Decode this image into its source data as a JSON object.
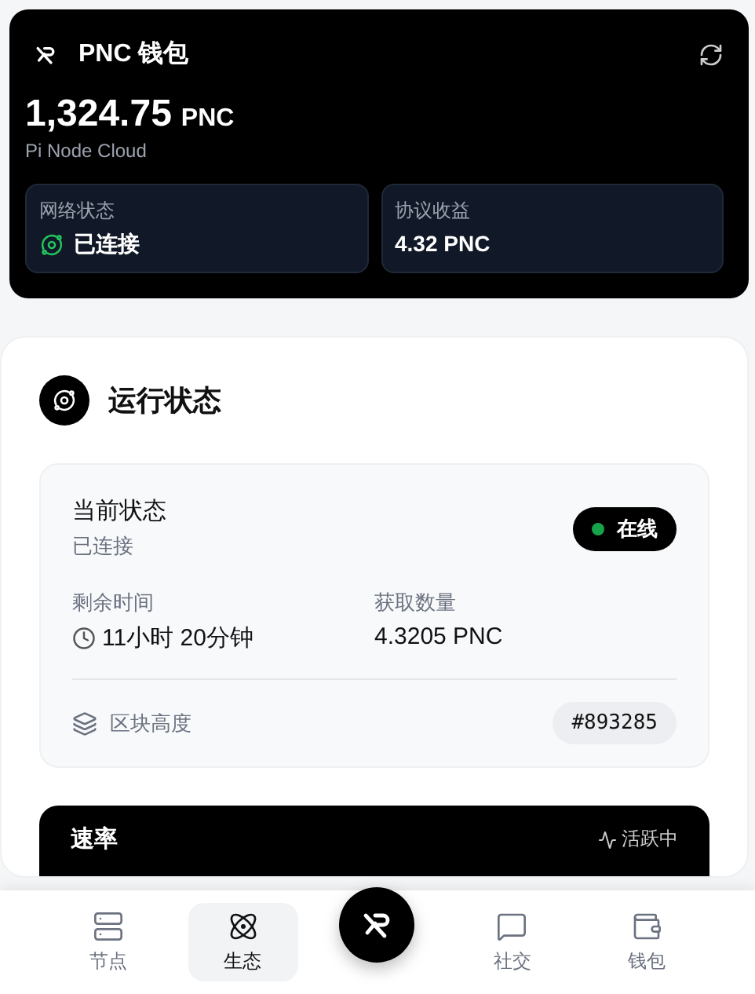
{
  "wallet": {
    "title": "PNC 钱包",
    "balance": "1,324.75",
    "unit": "PNC",
    "subtitle": "Pi Node Cloud",
    "stats": [
      {
        "label": "网络状态",
        "value": "已连接",
        "kind": "status"
      },
      {
        "label": "协议收益",
        "value": "4.32 PNC",
        "kind": "plain"
      }
    ]
  },
  "status_panel": {
    "title": "运行状态",
    "current_label": "当前状态",
    "current_value": "已连接",
    "badge": {
      "label": "在线",
      "color": "#16a34a"
    },
    "metrics": [
      {
        "label": "剩余时间",
        "value": "11小时 20分钟",
        "kind": "time"
      },
      {
        "label": "获取数量",
        "value": "4.3205 PNC",
        "kind": "plain"
      }
    ],
    "block": {
      "label": "区块高度",
      "value": "#893285"
    }
  },
  "rate_card": {
    "title": "速率",
    "status": "活跃中"
  },
  "nav": [
    {
      "label": "节点",
      "kind": "tab",
      "selected": false
    },
    {
      "label": "生态",
      "kind": "tab",
      "selected": true
    },
    {
      "kind": "center"
    },
    {
      "label": "社交",
      "kind": "tab",
      "selected": false
    },
    {
      "label": "钱包",
      "kind": "tab",
      "selected": false
    }
  ]
}
